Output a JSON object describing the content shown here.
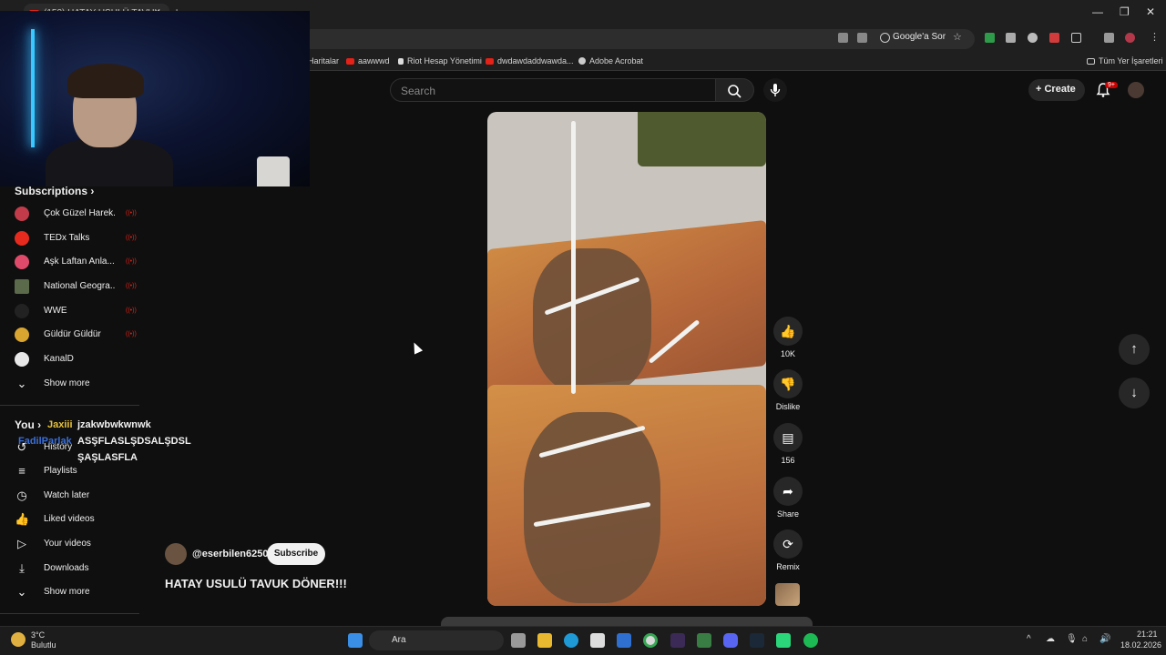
{
  "browser": {
    "tab_title": "(152) HATAY USULÜ TAVUK",
    "ask_button": "Google'a Sor",
    "bookmarks": [
      {
        "label": "Haritalar"
      },
      {
        "label": "aawwwd"
      },
      {
        "label": "Riot Hesap Yönetimi"
      },
      {
        "label": "dwdawdaddwawda..."
      },
      {
        "label": "Adobe Acrobat"
      }
    ],
    "all_bookmarks": "Tüm Yer İşaretleri"
  },
  "youtube": {
    "search_placeholder": "Search",
    "create_label": "Create",
    "notification_badge": "9+"
  },
  "sidebar": {
    "subscriptions_title": "Subscriptions",
    "subscriptions": [
      {
        "name": "Çok Güzel Harek...",
        "color": "#c23b4a"
      },
      {
        "name": "TEDx Talks",
        "color": "#e62b1e"
      },
      {
        "name": "Aşk Laftan Anla...",
        "color": "#e04a6a"
      },
      {
        "name": "National Geogra...",
        "color": "#5a6a4a"
      },
      {
        "name": "WWE",
        "color": "#222222"
      },
      {
        "name": "Güldür Güldür",
        "color": "#d9a530"
      },
      {
        "name": "KanalD",
        "color": "#e8e8e8"
      }
    ],
    "show_more_1": "Show more",
    "you_title": "You",
    "you_items": [
      {
        "label": "History",
        "icon": "history-icon"
      },
      {
        "label": "Playlists",
        "icon": "playlists-icon"
      },
      {
        "label": "Watch later",
        "icon": "watch-later-icon"
      },
      {
        "label": "Liked videos",
        "icon": "liked-icon"
      },
      {
        "label": "Your videos",
        "icon": "your-videos-icon"
      },
      {
        "label": "Downloads",
        "icon": "downloads-icon"
      }
    ],
    "show_more_2": "Show more"
  },
  "chat_overlay": {
    "user1": "Jaxiii",
    "msg1": "jzakwbwkwnwk",
    "user2": "FadilParlak",
    "msg2_line1": "ASŞFLASLŞDSALŞDSL",
    "msg2_line2": "ŞAŞLASFLA"
  },
  "short": {
    "channel": "@eserbilen6250",
    "subscribe_label": "Subscribe",
    "title": "HATAY USULÜ TAVUK DÖNER!!!",
    "likes": "10K",
    "dislike_label": "Dislike",
    "comments": "156",
    "share_label": "Share",
    "remix_label": "Remix"
  },
  "taskbar": {
    "weather_temp": "3°C",
    "weather_desc": "Bulutlu",
    "search_label": "Ara",
    "time": "21:21",
    "date": "18.02.2026"
  },
  "colors": {
    "accent_red": "#e62117",
    "background": "#0f0f0f"
  }
}
